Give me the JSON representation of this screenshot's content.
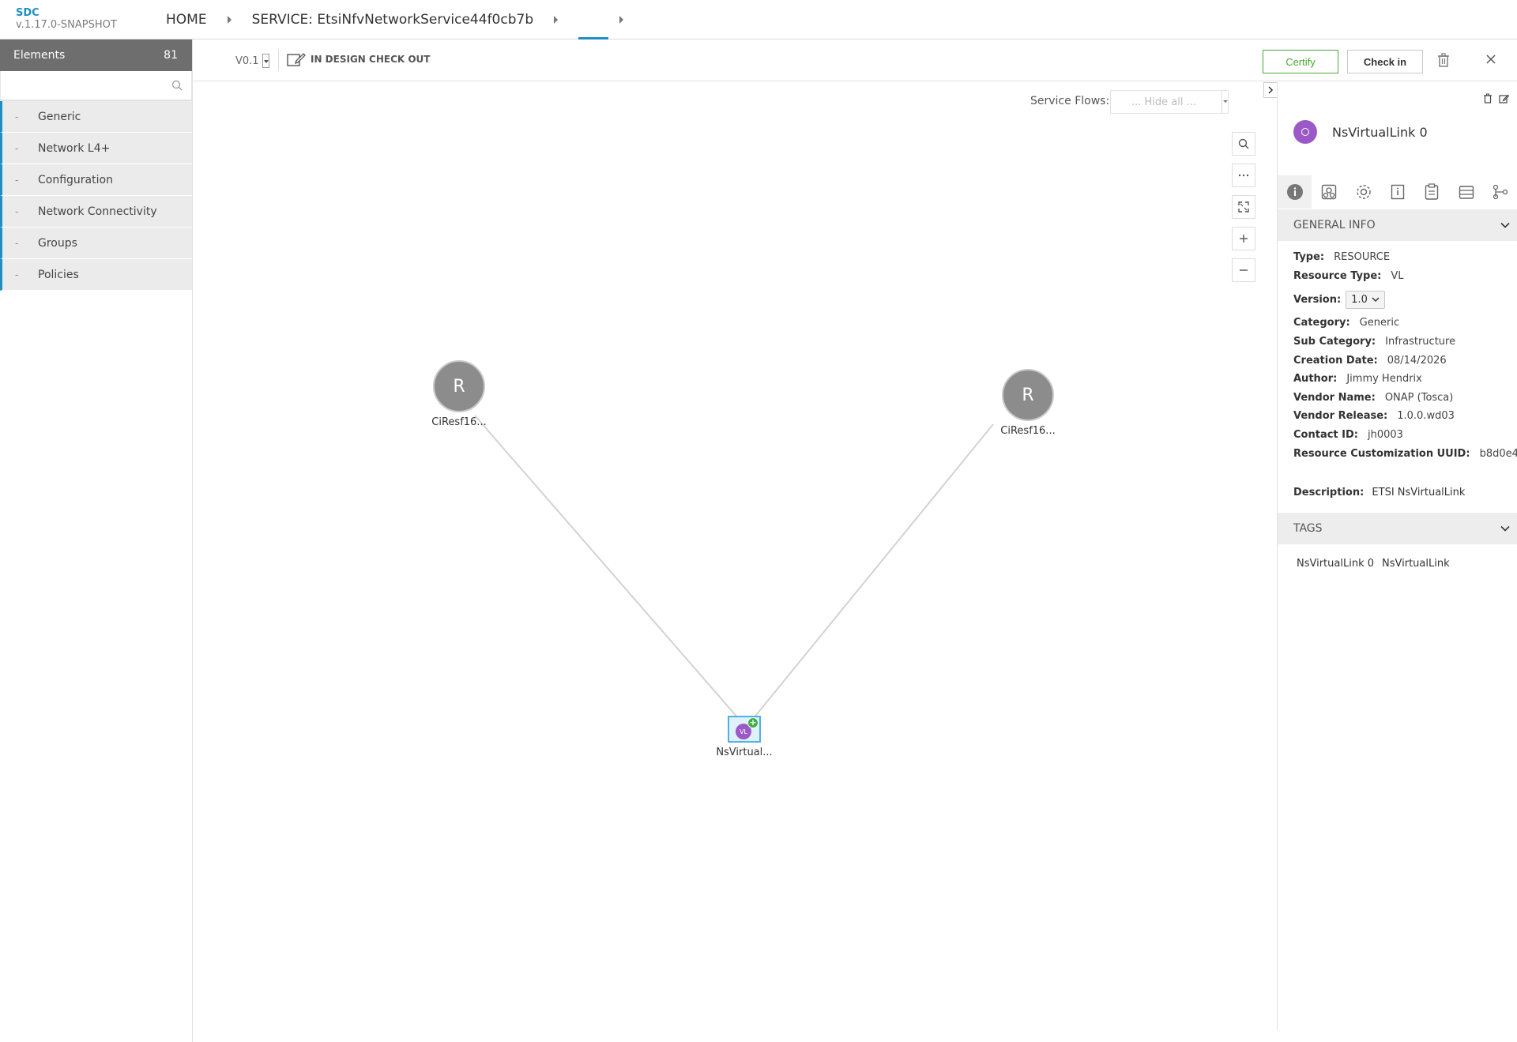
{
  "header": {
    "brand_name": "SDC",
    "brand_version": "v.1.17.0-SNAPSHOT",
    "breadcrumbs": [
      "HOME",
      "SERVICE: EtsiNfvNetworkService44f0cb7b"
    ]
  },
  "palette": {
    "title": "Elements",
    "count": "81",
    "search_placeholder": "",
    "dash": "-",
    "groups": [
      "Generic",
      "Network L4+",
      "Configuration",
      "Network Connectivity",
      "Groups",
      "Policies"
    ]
  },
  "toolbar": {
    "version": "V0.1",
    "status": "IN DESIGN CHECK OUT",
    "certify_label": "Certify",
    "checkin_label": "Check in"
  },
  "canvas": {
    "service_flows_label": "Service Flows:",
    "service_flows_value": "... Hide all ...",
    "zoom_buttons": [
      "search-icon",
      "more-icon",
      "fit-icon",
      "plus-icon",
      "minus-icon"
    ],
    "nodes": [
      {
        "letter": "R",
        "label": "CiResf16..."
      },
      {
        "letter": "R",
        "label": "CiResf16..."
      },
      {
        "letter": "VL",
        "label": "NsVirtual..."
      }
    ]
  },
  "details": {
    "name": "NsVirtualLink 0",
    "general_info_title": "GENERAL INFO",
    "type_label": "Type:",
    "type_value": "RESOURCE",
    "resource_type_label": "Resource Type:",
    "resource_type_value": "VL",
    "version_label": "Version:",
    "version_value": "1.0",
    "category_label": "Category:",
    "category_value": "Generic",
    "sub_category_label": "Sub Category:",
    "sub_category_value": "Infrastructure",
    "creation_date_label": "Creation Date:",
    "creation_date_value": "08/14/2026",
    "author_label": "Author:",
    "author_value": "Jimmy Hendrix",
    "vendor_name_label": "Vendor Name:",
    "vendor_name_value": "ONAP (Tosca)",
    "vendor_release_label": "Vendor Release:",
    "vendor_release_value": "1.0.0.wd03",
    "contact_id_label": "Contact ID:",
    "contact_id_value": "jh0003",
    "uuid_label": "Resource Customization UUID:",
    "uuid_value": "b8d0e4...",
    "description_label": "Description:",
    "description_value": "ETSI NsVirtualLink",
    "tags_title": "TAGS",
    "tags": [
      "NsVirtualLink 0",
      "NsVirtualLink"
    ]
  },
  "colors": {
    "accent": "#1f8fc3",
    "certify": "#4aa833",
    "vl_node": "#9b59c7"
  }
}
